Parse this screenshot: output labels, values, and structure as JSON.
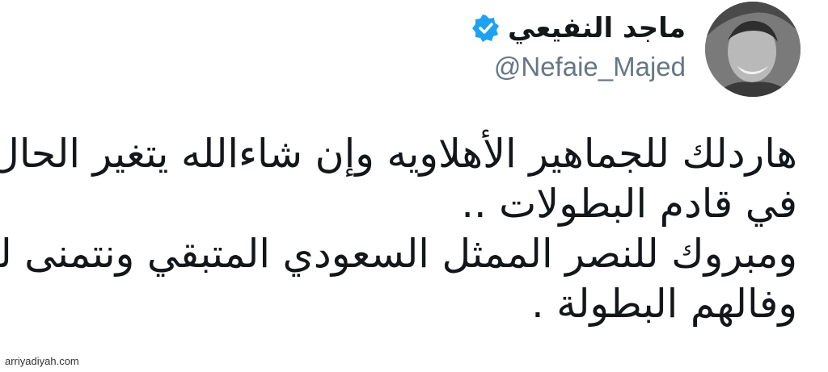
{
  "user": {
    "display_name": "ماجد النفيعي",
    "handle": "@Nefaie_Majed",
    "verified": true,
    "avatar_icon": "avatar-photo-icon"
  },
  "tweet": {
    "lines": [
      "هاردلك للجماهير الأهلاويه وإن شاءالله يتغير الحال",
      "في قادم البطولات ..",
      "ومبروك للنصر الممثل السعودي المتبقي ونتمنى له",
      "وفالهم البطولة ."
    ]
  },
  "watermark": "arriyadiyah.com",
  "colors": {
    "verified": "#1da1f2",
    "handle": "#657786",
    "text": "#14171a"
  }
}
